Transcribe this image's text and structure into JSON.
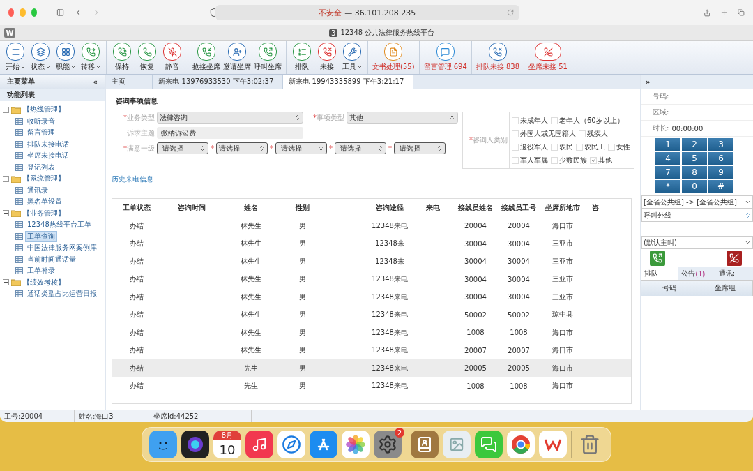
{
  "browser": {
    "security": "不安全",
    "address": "— 36.101.208.235",
    "tab_icon": "W",
    "page_favicon": "3",
    "page_title": "12348 公共法律服务热线平台"
  },
  "toolbar": [
    [
      {
        "kind": "start",
        "label": "开始",
        "dropdown": true,
        "alert": false
      },
      {
        "kind": "status",
        "label": "状态",
        "dropdown": true,
        "alert": false
      },
      {
        "kind": "role",
        "label": "职能",
        "dropdown": true,
        "alert": false
      },
      {
        "kind": "transfer",
        "label": "转移",
        "dropdown": true,
        "alert": false
      }
    ],
    [
      {
        "kind": "hold",
        "label": "保持",
        "dropdown": false,
        "alert": false
      },
      {
        "kind": "resume",
        "label": "恢复",
        "dropdown": false,
        "alert": false
      },
      {
        "kind": "mute",
        "label": "静音",
        "dropdown": false,
        "alert": false
      }
    ],
    [
      {
        "kind": "grab",
        "label": "抢接坐席",
        "dropdown": false,
        "alert": false
      },
      {
        "kind": "invite",
        "label": "邀请坐席",
        "dropdown": false,
        "alert": false
      },
      {
        "kind": "callseat",
        "label": "呼叫坐席",
        "dropdown": false,
        "alert": false
      }
    ],
    [
      {
        "kind": "queue",
        "label": "排队",
        "dropdown": false,
        "alert": false
      },
      {
        "kind": "missed",
        "label": "未接",
        "dropdown": false,
        "alert": false
      },
      {
        "kind": "tools",
        "label": "工具",
        "dropdown": true,
        "alert": false
      }
    ],
    [
      {
        "kind": "document",
        "label": "文书处理(55)",
        "dropdown": false,
        "alert": true
      }
    ],
    [
      {
        "kind": "message",
        "label": "留言管理 694",
        "dropdown": false,
        "alert": true
      }
    ],
    [
      {
        "kind": "queuemissed",
        "label": "排队未接 838",
        "dropdown": false,
        "alert": true
      }
    ],
    [
      {
        "kind": "hangup",
        "label": "坐席未接 51",
        "dropdown": false,
        "alert": true
      }
    ]
  ],
  "sidebar": {
    "title": "主要菜单",
    "collapse": "«",
    "section": "功能列表",
    "tree": [
      {
        "label": "【热线管理】",
        "expanded": true,
        "children": [
          {
            "label": "收听录音",
            "selected": false
          },
          {
            "label": "留言管理",
            "selected": false
          },
          {
            "label": "排队未接电话",
            "selected": false
          },
          {
            "label": "坐席未接电话",
            "selected": false
          },
          {
            "label": "登记列表",
            "selected": false
          }
        ]
      },
      {
        "label": "【系统管理】",
        "expanded": true,
        "children": [
          {
            "label": "通讯录",
            "selected": false
          },
          {
            "label": "黑名单设置",
            "selected": false
          }
        ]
      },
      {
        "label": "【业务管理】",
        "expanded": true,
        "children": [
          {
            "label": "12348热线平台工单",
            "selected": false
          },
          {
            "label": "工单查询",
            "selected": true
          },
          {
            "label": "中国法律服务网案例库",
            "selected": false
          },
          {
            "label": "当前时间通话量",
            "selected": false
          },
          {
            "label": "工单补录",
            "selected": false
          }
        ]
      },
      {
        "label": "【绩效考核】",
        "expanded": true,
        "children": [
          {
            "label": "通话类型占比运营日报",
            "selected": false
          }
        ]
      }
    ]
  },
  "tabs": [
    {
      "label": "主页",
      "selected": false
    },
    {
      "label": "新来电-13976933530 下午3:02:37",
      "selected": false
    },
    {
      "label": "新来电-19943335899 下午3:21:17",
      "selected": true
    }
  ],
  "form": {
    "title": "咨询事项信息",
    "business_type": {
      "mark": "*",
      "label": "业务类型",
      "value": "法律咨询"
    },
    "matter_type": {
      "mark": "*",
      "label": "事项类型",
      "value": "其他"
    },
    "subject": {
      "label": "诉求主题",
      "value": "缴纳诉讼费"
    },
    "level_selects": {
      "mark": "*",
      "label": "满意一级",
      "options": [
        {
          "mark": "*",
          "value": "-请选择-"
        },
        {
          "mark": "*",
          "value": "请选择"
        },
        {
          "mark": "*",
          "value": "-请选择-"
        },
        {
          "mark": "*",
          "value": "-请选择-"
        },
        {
          "value": "-请选择-"
        }
      ]
    },
    "consultant_type": {
      "mark": "*",
      "label": "咨询人类别",
      "rows": [
        [
          {
            "label": "未成年人",
            "checked": false
          },
          {
            "label": "老年人（60岁以上）",
            "checked": false
          }
        ],
        [
          {
            "label": "外国人或无国籍人",
            "checked": false
          },
          {
            "label": "残疾人",
            "checked": false
          }
        ],
        [
          {
            "label": "退役军人",
            "checked": false
          },
          {
            "label": "农民",
            "checked": false
          },
          {
            "label": "农民工",
            "checked": false
          },
          {
            "label": "女性",
            "checked": false
          }
        ],
        [
          {
            "label": "军人军属",
            "checked": false
          },
          {
            "label": "少数民族",
            "checked": false
          },
          {
            "label": "其他",
            "checked": true
          }
        ]
      ]
    },
    "history_link": "历史来电信息"
  },
  "table": {
    "columns": [
      "工单状态",
      "咨询时间",
      "姓名",
      "性别",
      null,
      "咨询途径",
      "来电",
      "接线员姓名",
      "接线员工号",
      "坐席所地市",
      "咨"
    ],
    "rows": [
      {
        "selected": false,
        "cells": [
          "办结",
          null,
          "林先生",
          "男",
          null,
          "12348来电",
          null,
          "20004",
          "20004",
          "海口市"
        ]
      },
      {
        "selected": false,
        "cells": [
          "办结",
          null,
          "林先生",
          "男",
          null,
          "12348来",
          null,
          "30004",
          "30004",
          "三亚市"
        ]
      },
      {
        "selected": false,
        "cells": [
          "办结",
          null,
          "林先生",
          "男",
          null,
          "12348来",
          null,
          "30004",
          "30004",
          "三亚市"
        ]
      },
      {
        "selected": false,
        "cells": [
          "办结",
          null,
          "林先生",
          "男",
          null,
          "12348来电",
          null,
          "30004",
          "30004",
          "三亚市"
        ]
      },
      {
        "selected": false,
        "cells": [
          "办结",
          null,
          "林先生",
          "男",
          null,
          "12348来电",
          null,
          "30004",
          "30004",
          "三亚市"
        ]
      },
      {
        "selected": false,
        "cells": [
          "办结",
          null,
          "林先生",
          "男",
          null,
          "12348来电",
          null,
          "50002",
          "50002",
          "琼中县"
        ]
      },
      {
        "selected": false,
        "cells": [
          "办结",
          null,
          "林先生",
          "男",
          null,
          "12348来电",
          null,
          "1008",
          "1008",
          "海口市"
        ]
      },
      {
        "selected": false,
        "cells": [
          "办结",
          null,
          "林先生",
          "男",
          null,
          "12348来电",
          null,
          "20007",
          "20007",
          "海口市"
        ]
      },
      {
        "selected": true,
        "cells": [
          "办结",
          null,
          "先生",
          "男",
          null,
          "12348来电",
          null,
          "20005",
          "20005",
          "海口市"
        ]
      },
      {
        "selected": false,
        "cells": [
          "办结",
          null,
          "先生",
          "男",
          null,
          "12348来电",
          null,
          "1008",
          "1008",
          "海口市"
        ]
      }
    ]
  },
  "phone": {
    "expand": "»",
    "fields": [
      {
        "label": "号码:"
      },
      {
        "label": "区域:"
      },
      {
        "label": "时长:",
        "value": "00:00:00"
      }
    ],
    "keys": [
      "1",
      "2",
      "3",
      "4",
      "5",
      "6",
      "7",
      "8",
      "9",
      "*",
      "0",
      "#"
    ],
    "group_select": "[全省公共组] -> [全省公共组]",
    "line_select": "呼叫外线",
    "caller_select": "(默认主叫)",
    "tabs": [
      {
        "label": "排队",
        "selected": true
      },
      {
        "label": "公告",
        "count": "(1)",
        "selected": false
      },
      {
        "label": "通讯:",
        "selected": false
      }
    ],
    "columns": [
      "号码",
      "坐席组"
    ]
  },
  "status_bar": [
    "工号:20004",
    "姓名:海口3",
    "坐席Id:44252"
  ],
  "dock": [
    {
      "kind": "finder"
    },
    {
      "kind": "siri"
    },
    {
      "kind": "calendar",
      "month": "8月",
      "day": "10"
    },
    {
      "kind": "music"
    },
    {
      "kind": "safari"
    },
    {
      "kind": "appstore"
    },
    {
      "kind": "photos"
    },
    {
      "kind": "settings",
      "badge": "2"
    },
    {
      "kind": "divider"
    },
    {
      "kind": "contacts"
    },
    {
      "kind": "preview"
    },
    {
      "kind": "wechat"
    },
    {
      "kind": "chrome"
    },
    {
      "kind": "wps"
    },
    {
      "kind": "divider"
    },
    {
      "kind": "trash"
    }
  ]
}
